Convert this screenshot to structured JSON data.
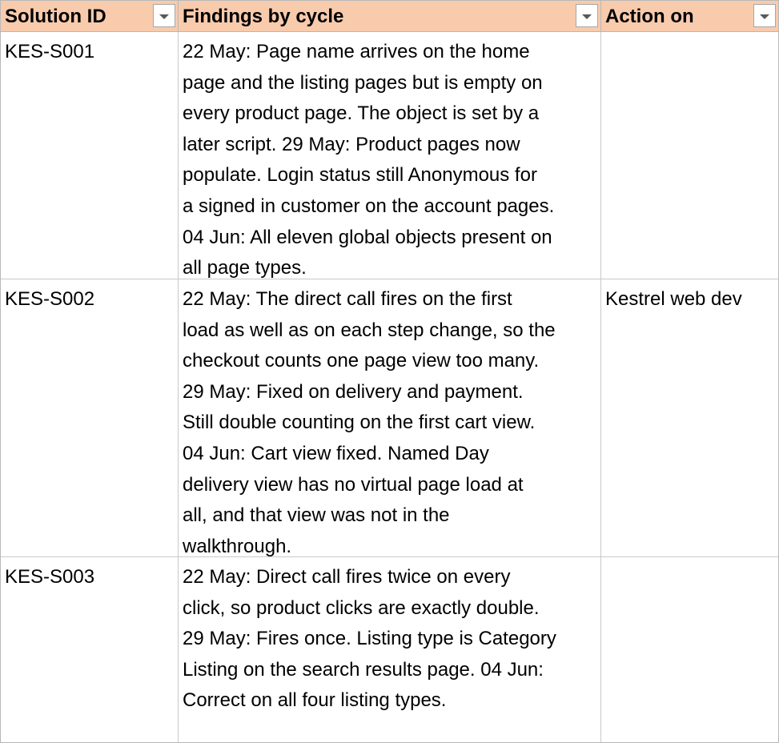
{
  "table": {
    "headers": [
      {
        "label": "Solution ID"
      },
      {
        "label": "Findings by cycle"
      },
      {
        "label": "Action on"
      }
    ],
    "rows": [
      {
        "solution_id": "KES-S001",
        "findings_lines": [
          "22 May: Page name arrives on the home",
          "page and the listing pages but is empty on",
          "every product page. The object is set by a",
          "later script. 29 May: Product pages now",
          "populate. Login status still Anonymous for",
          "a signed in customer on the account pages.",
          "04 Jun: All eleven global objects present on",
          "all page types."
        ],
        "action_on": ""
      },
      {
        "solution_id": "KES-S002",
        "findings_lines": [
          "22 May: The direct call fires on the first",
          "load as well as on each step change, so the",
          "checkout counts one page view too many.",
          "29 May: Fixed on delivery and payment.",
          "Still double counting on the first cart view.",
          "04 Jun: Cart view fixed. Named Day",
          "delivery view has no virtual page load at",
          "all, and that view was not in the",
          "walkthrough."
        ],
        "action_on": "Kestrel web dev"
      },
      {
        "solution_id": "KES-S003",
        "findings_lines": [
          "22 May: Direct call fires twice on every",
          "click, so product clicks are exactly double.",
          "29 May: Fires once. Listing type is Category",
          "Listing on the search results page. 04 Jun:",
          "Correct on all four listing types."
        ],
        "action_on": ""
      }
    ]
  },
  "colors": {
    "header_fill": "#f8cbad",
    "gridline": "#c9c9c9"
  },
  "icons": {
    "filter": "chevron-down-icon"
  }
}
